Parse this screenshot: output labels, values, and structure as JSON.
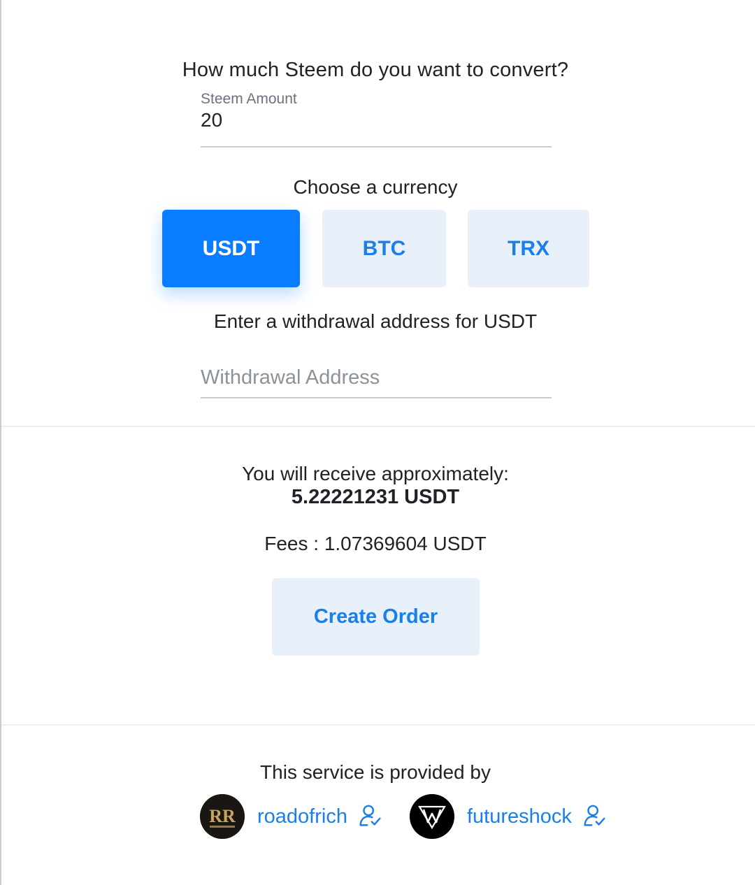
{
  "convert": {
    "question": "How much Steem do you want to convert?",
    "amount_label": "Steem Amount",
    "amount_value": "20"
  },
  "currency": {
    "heading": "Choose a currency",
    "options": [
      {
        "label": "USDT",
        "selected": true
      },
      {
        "label": "BTC",
        "selected": false
      },
      {
        "label": "TRX",
        "selected": false
      }
    ]
  },
  "withdrawal": {
    "label": "Enter a withdrawal address for USDT",
    "placeholder": "Withdrawal Address"
  },
  "summary": {
    "receive_label": "You will receive approximately:",
    "receive_value": "5.22221231 USDT",
    "fees": "Fees : 1.07369604 USDT"
  },
  "actions": {
    "create_order": "Create Order"
  },
  "footer": {
    "provided_by": "This service is provided by",
    "providers": [
      {
        "name": "roadofrich",
        "icon": "verified-user-icon"
      },
      {
        "name": "futureshock",
        "icon": "verified-user-icon"
      }
    ]
  },
  "colors": {
    "accent": "#0a7cff",
    "link": "#1a7fe8",
    "button_light": "#e8f1fa"
  }
}
